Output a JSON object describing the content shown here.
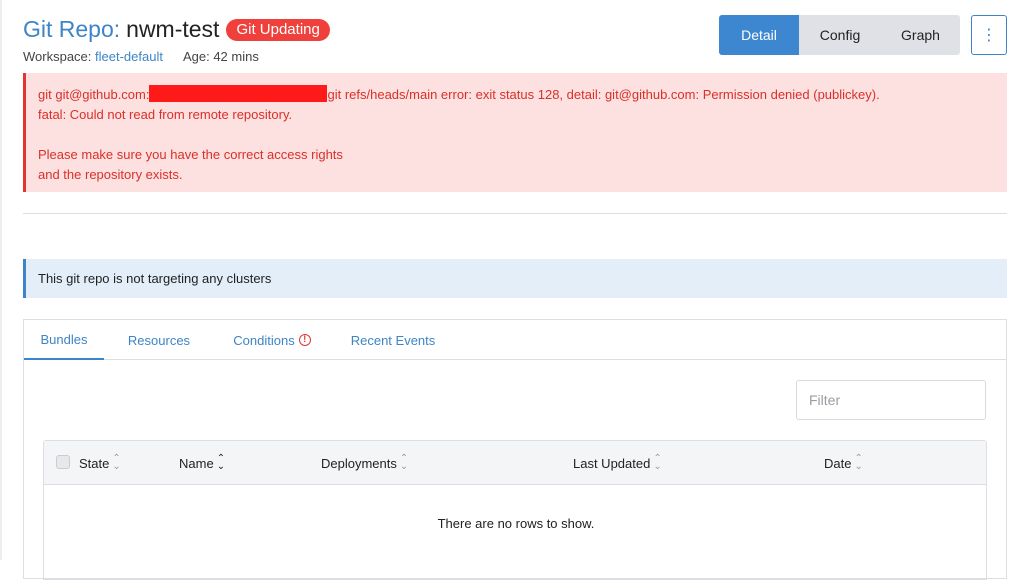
{
  "header": {
    "title_prefix": "Git Repo:",
    "title_name": "nwm-test",
    "badge": "Git Updating",
    "workspace_label": "Workspace:",
    "workspace_value": "fleet-default",
    "age": "Age: 42 mins"
  },
  "view_buttons": [
    {
      "label": "Detail"
    },
    {
      "label": "Config"
    },
    {
      "label": "Graph"
    }
  ],
  "actions": {
    "menu_glyph": "⋮"
  },
  "error": {
    "line1_prefix": "git git@github.com:",
    "line1_suffix": "git refs/heads/main error: exit status 128, detail: git@github.com: Permission denied (publickey).",
    "line2": "fatal: Could not read from remote repository.",
    "line3": "Please make sure you have the correct access rights",
    "line4": "and the repository exists."
  },
  "info": {
    "message": "This git repo is not targeting any clusters"
  },
  "tabs": [
    {
      "label": "Bundles"
    },
    {
      "label": "Resources"
    },
    {
      "label": "Conditions"
    },
    {
      "label": "Recent Events"
    }
  ],
  "filter": {
    "placeholder": "Filter"
  },
  "table": {
    "columns": [
      "State",
      "Name",
      "Deployments",
      "Last Updated",
      "Date"
    ],
    "empty_message": "There are no rows to show."
  },
  "colors": {
    "accent": "#3d85c6",
    "error": "#e2352f",
    "badge": "#f0403c"
  }
}
